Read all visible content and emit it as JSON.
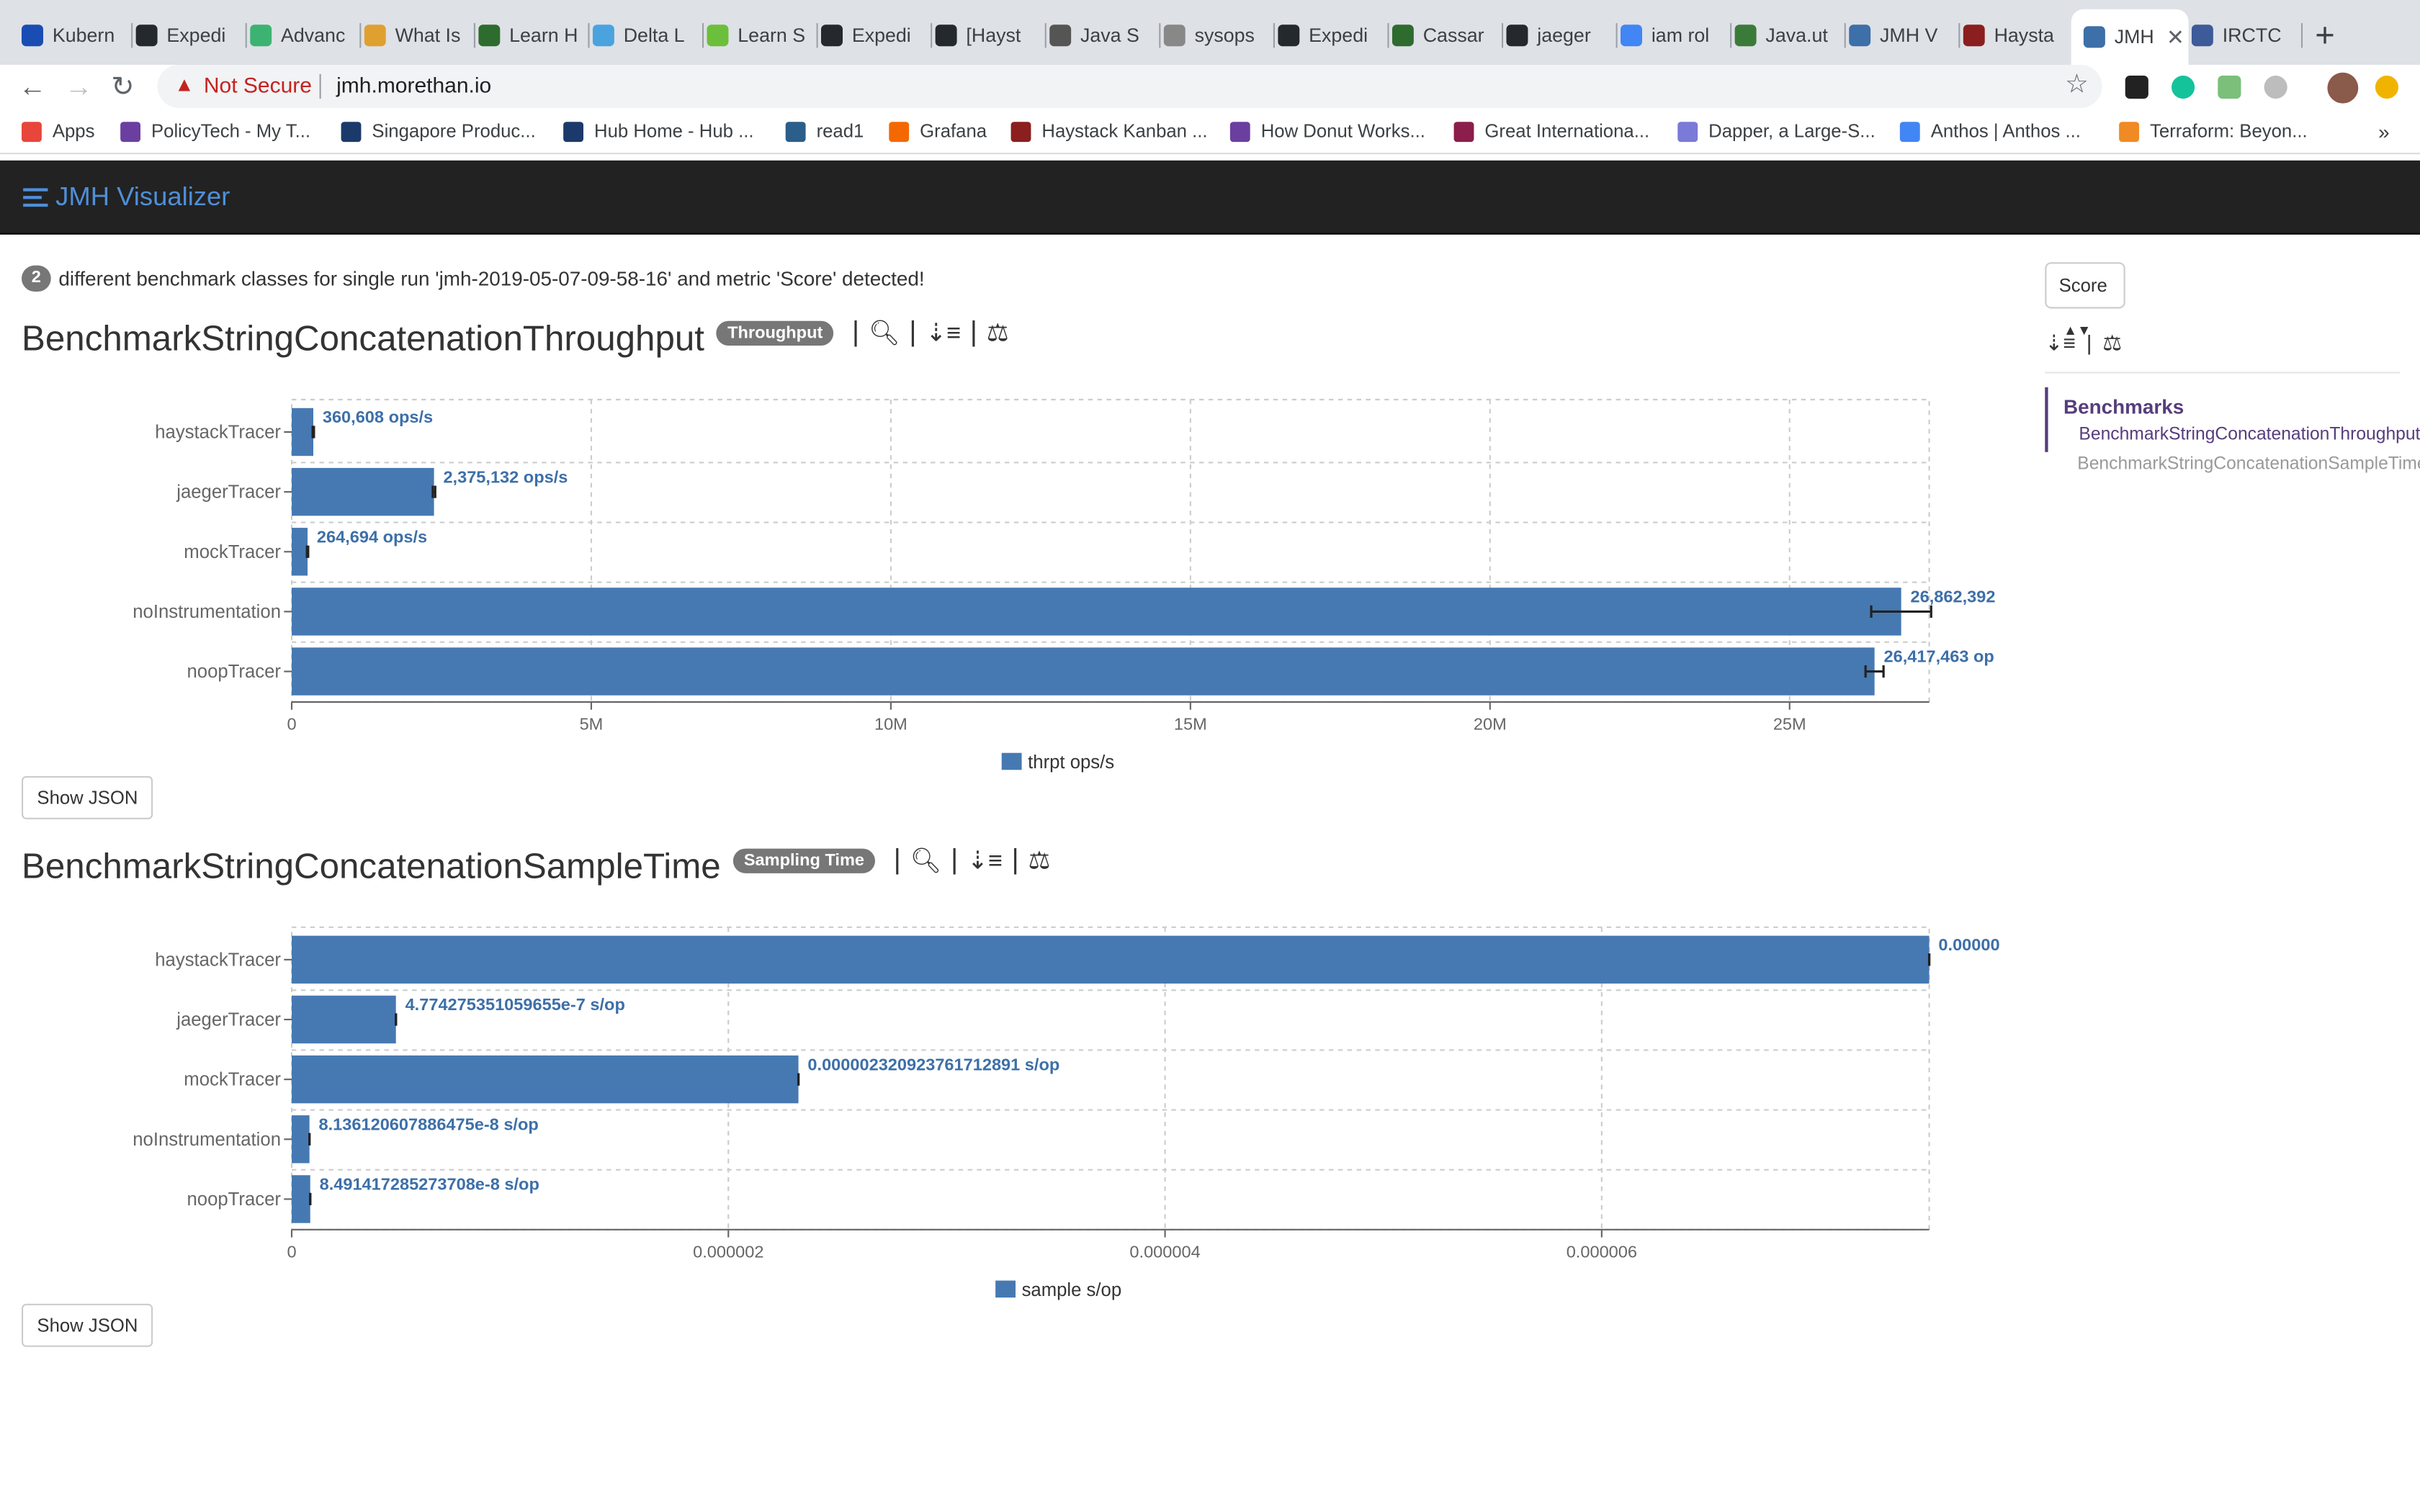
{
  "browser": {
    "tabs": [
      {
        "label": "Kubern",
        "color": "#1a4db3"
      },
      {
        "label": "Expedi",
        "color": "#24292e"
      },
      {
        "label": "Advanc",
        "color": "#3cb371"
      },
      {
        "label": "What Is",
        "color": "#e0a030"
      },
      {
        "label": "Learn H",
        "color": "#2e6b2e"
      },
      {
        "label": "Delta L",
        "color": "#4aa3df"
      },
      {
        "label": "Learn S",
        "color": "#6bbf3a"
      },
      {
        "label": "Expedi",
        "color": "#24292e"
      },
      {
        "label": "[Hayst",
        "color": "#24292e"
      },
      {
        "label": "Java S",
        "color": "#555555"
      },
      {
        "label": "sysops",
        "color": "#888888"
      },
      {
        "label": "Expedi",
        "color": "#24292e"
      },
      {
        "label": "Cassar",
        "color": "#2e6b2e"
      },
      {
        "label": "jaeger",
        "color": "#24292e"
      },
      {
        "label": "iam rol",
        "color": "#4285f4"
      },
      {
        "label": "Java.ut",
        "color": "#3a7b3a"
      },
      {
        "label": "JMH V",
        "color": "#3d6fa8"
      },
      {
        "label": "Haysta",
        "color": "#8b1e1e"
      },
      {
        "label": "JMH",
        "color": "#3d6fa8"
      },
      {
        "label": "IRCTC",
        "color": "#3d5a99"
      }
    ],
    "url_warning": "Not Secure",
    "url": "jmh.morethan.io",
    "bookmarks": [
      {
        "label": "Apps",
        "color": "#e8453c"
      },
      {
        "label": "PolicyTech - My T...",
        "color": "#6b3fa0"
      },
      {
        "label": "Singapore Produc...",
        "color": "#1b3a6b"
      },
      {
        "label": "Hub Home - Hub ...",
        "color": "#1b3a6b"
      },
      {
        "label": "read1",
        "color": "#2b5e8a"
      },
      {
        "label": "Grafana",
        "color": "#f46800"
      },
      {
        "label": "Haystack Kanban ...",
        "color": "#8b1e1e"
      },
      {
        "label": "How Donut Works...",
        "color": "#6b3fa0"
      },
      {
        "label": "Great Internationa...",
        "color": "#8b1e4a"
      },
      {
        "label": "Dapper, a Large-S...",
        "color": "#7a7ad8"
      },
      {
        "label": "Anthos  |  Anthos ...",
        "color": "#4285f4"
      },
      {
        "label": "Terraform: Beyon...",
        "color": "#f08a24"
      }
    ]
  },
  "app": {
    "brand": "JMH Visualizer",
    "notice": {
      "count": "2",
      "text": "different benchmark classes for single run 'jmh-2019-05-07-09-58-16' and metric 'Score' detected!"
    },
    "score_select": "Score",
    "show_json_label": "Show JSON",
    "sidebar": {
      "heading": "Benchmarks",
      "items": [
        "BenchmarkStringConcatenationThroughput",
        "BenchmarkStringConcatenationSampleTime"
      ]
    }
  },
  "benchmarks": [
    {
      "title": "BenchmarkStringConcatenationThroughput",
      "mode": "Throughput"
    },
    {
      "title": "BenchmarkStringConcatenationSampleTime",
      "mode": "Sampling Time"
    }
  ],
  "chart_data": [
    {
      "type": "bar",
      "orientation": "horizontal",
      "categories": [
        "haystackTracer",
        "jaegerTracer",
        "mockTracer",
        "noInstrumentation",
        "noopTracer"
      ],
      "values": [
        360608,
        2375132,
        264694,
        26862392,
        26417463
      ],
      "value_labels": [
        "360,608 ops/s",
        "2,375,132 ops/s",
        "264,694 ops/s",
        "26,862,392",
        "26,417,463 op"
      ],
      "error": [
        10000,
        20000,
        10000,
        500000,
        150000
      ],
      "xlim": [
        0,
        27330000
      ],
      "xticks": [
        0,
        5000000,
        10000000,
        15000000,
        20000000,
        25000000
      ],
      "xtick_labels": [
        "0",
        "5M",
        "10M",
        "15M",
        "20M",
        "25M"
      ],
      "legend": "thrpt ops/s",
      "color": "#4679b2",
      "grid": true
    },
    {
      "type": "bar",
      "orientation": "horizontal",
      "categories": [
        "haystackTracer",
        "jaegerTracer",
        "mockTracer",
        "noInstrumentation",
        "noopTracer"
      ],
      "values": [
        7.5e-06,
        4.774275351059655e-07,
        2.320923761712891e-06,
        8.136120607886475e-08,
        8.491417285273708e-08
      ],
      "value_labels": [
        "0.00000",
        "4.774275351059655e-7 s/op",
        "0.000002320923761712891 s/op",
        "8.136120607886475e-8 s/op",
        "8.491417285273708e-8 s/op"
      ],
      "error": [
        0.0,
        0.0,
        0.0,
        0.0,
        0.0
      ],
      "xlim": [
        0,
        7.5e-06
      ],
      "xticks": [
        0,
        2e-06,
        4e-06,
        6e-06
      ],
      "xtick_labels": [
        "0",
        "0.000002",
        "0.000004",
        "0.000006"
      ],
      "legend": "sample s/op",
      "color": "#4679b2",
      "grid": true
    }
  ]
}
